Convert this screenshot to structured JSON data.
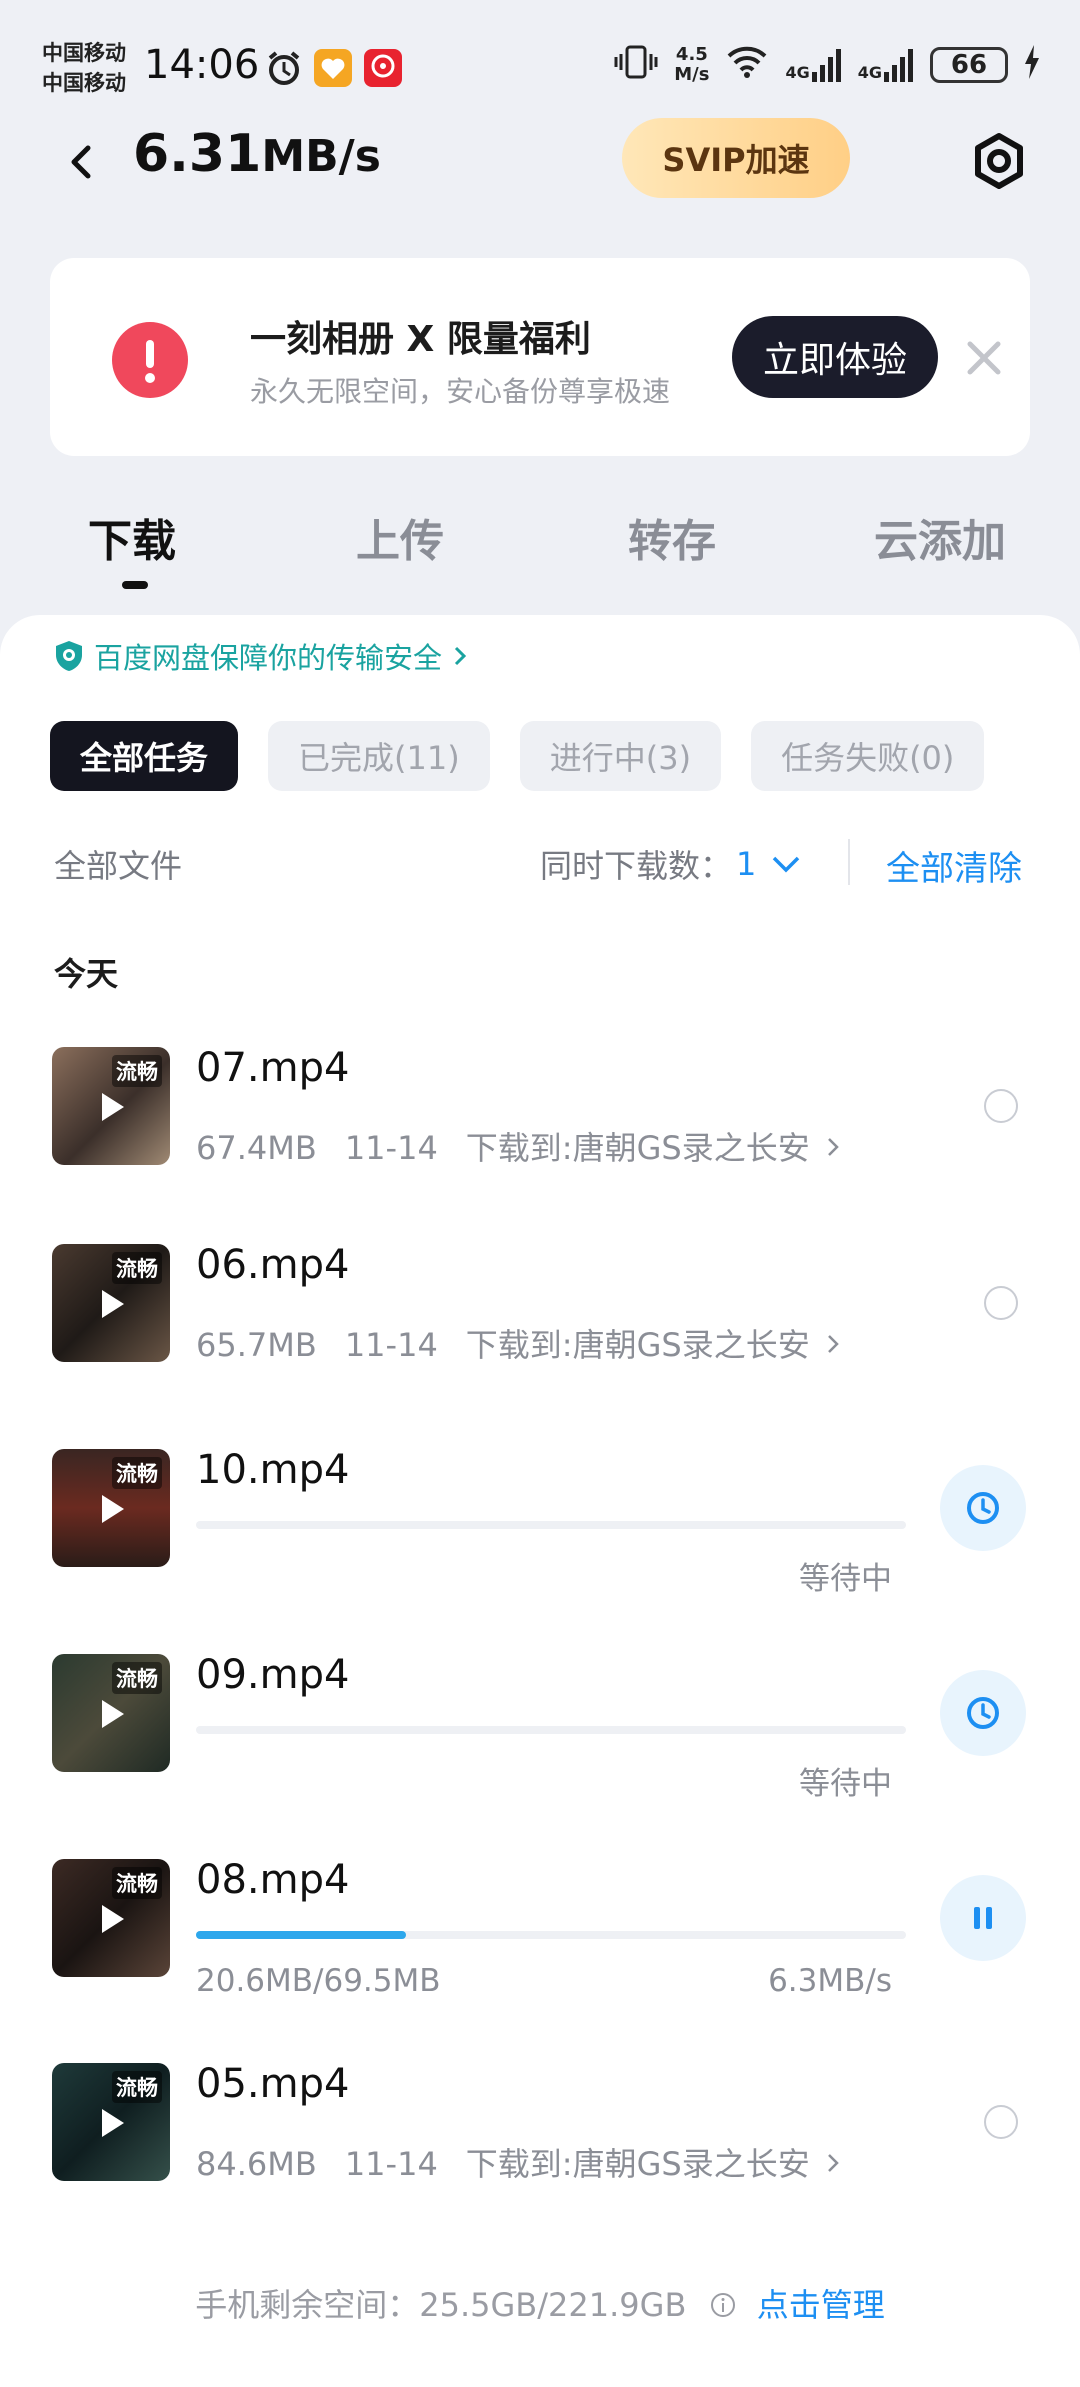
{
  "status_bar": {
    "carrier_1": "中国移动",
    "carrier_2": "中国移动",
    "time": "14:06",
    "net_speed_value": "4.5",
    "net_speed_unit": "M/s",
    "signal_1": "4G",
    "signal_2": "4G",
    "battery": "66"
  },
  "header": {
    "speed_value": "6.31",
    "speed_unit": "MB/s",
    "svip_label": "SVIP加速"
  },
  "promo": {
    "title": "一刻相册 X 限量福利",
    "subtitle": "永久无限空间，安心备份尊享极速",
    "button": "立即体验"
  },
  "tabs": [
    "下载",
    "上传",
    "转存",
    "云添加"
  ],
  "security_notice": "百度网盘保障你的传输安全",
  "filters": [
    "全部任务",
    "已完成(11)",
    "进行中(3)",
    "任务失败(0)"
  ],
  "toolbar": {
    "all_files": "全部文件",
    "concurrency_label": "同时下载数：",
    "concurrency_value": "1",
    "clear_all": "全部清除"
  },
  "section_today": "今天",
  "thumb_tag": "流畅",
  "items": [
    {
      "name": "07.mp4",
      "size": "67.4MB",
      "date": "11-14",
      "dest": "下载到:唐朝GS录之长安"
    },
    {
      "name": "06.mp4",
      "size": "65.7MB",
      "date": "11-14",
      "dest": "下载到:唐朝GS录之长安"
    },
    {
      "name": "10.mp4",
      "status": "等待中",
      "progress": 0
    },
    {
      "name": "09.mp4",
      "status": "等待中",
      "progress": 0
    },
    {
      "name": "08.mp4",
      "transferred": "20.6MB/69.5MB",
      "speed": "6.3MB/s",
      "progress": 0.296
    },
    {
      "name": "05.mp4",
      "size": "84.6MB",
      "date": "11-14",
      "dest": "下载到:唐朝GS录之长安"
    }
  ],
  "footer": {
    "storage_label": "手机剩余空间：",
    "storage_value": "25.5GB/221.9GB",
    "manage": "点击管理"
  },
  "colors": {
    "accent_blue": "#1d8ff2",
    "progress_blue": "#2da7ec",
    "promo_red": "#f0485c",
    "svip_gold": "#ffcf86"
  }
}
